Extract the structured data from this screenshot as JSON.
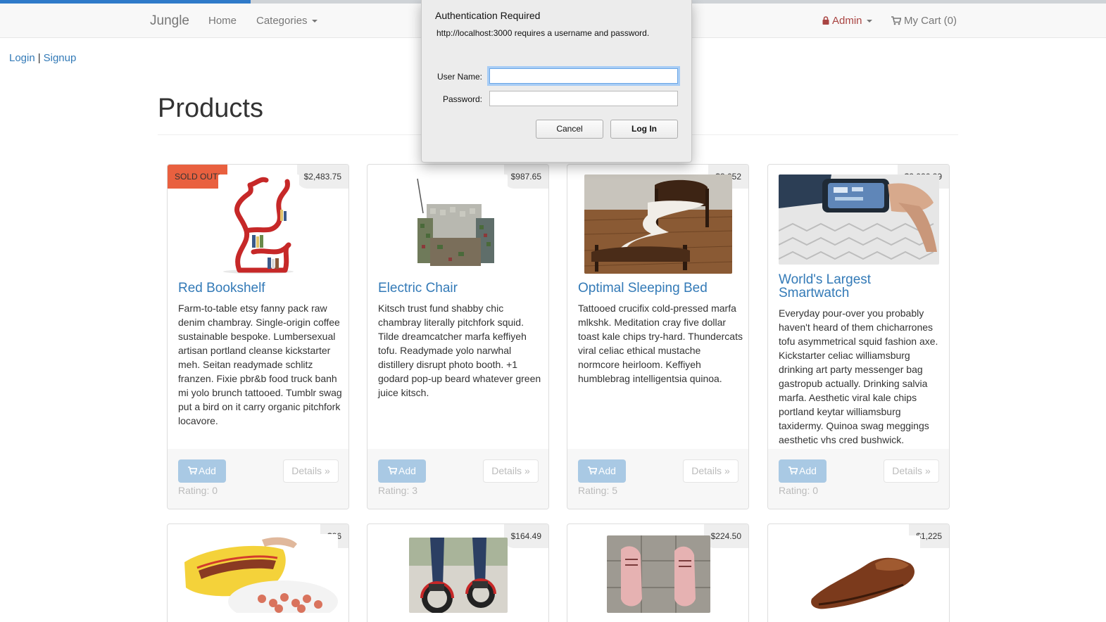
{
  "nav": {
    "brand": "Jungle",
    "home": "Home",
    "categories": "Categories",
    "admin": "Admin",
    "cart": "My Cart (0)"
  },
  "auth_links": {
    "login": "Login",
    "separator": "|",
    "signup": "Signup"
  },
  "page_title": "Products",
  "products": [
    {
      "name": "Red Bookshelf",
      "price": "$2,483.75",
      "badge": "SOLD OUT!",
      "description": "Farm-to-table etsy fanny pack raw denim chambray. Single-origin coffee sustainable bespoke. Lumbersexual artisan portland cleanse kickstarter meh. Seitan readymade schlitz franzen. Fixie pbr&b food truck banh mi yolo brunch tattooed. Tumblr swag put a bird on it carry organic pitchfork locavore.",
      "add_label": "Add",
      "details_label": "Details »",
      "rating": "Rating: 0"
    },
    {
      "name": "Electric Chair",
      "price": "$987.65",
      "description": "Kitsch trust fund shabby chic chambray literally pitchfork squid. Tilde dreamcatcher marfa keffiyeh tofu. Readymade yolo narwhal distillery disrupt photo booth. +1 godard pop-up beard whatever green juice kitsch.",
      "add_label": "Add",
      "details_label": "Details »",
      "rating": "Rating: 3"
    },
    {
      "name": "Optimal Sleeping Bed",
      "price": "$3,052",
      "description": "Tattooed crucifix cold-pressed marfa mlkshk. Meditation cray five dollar toast kale chips try-hard. Thundercats viral celiac ethical mustache normcore heirloom. Keffiyeh humblebrag intelligentsia quinoa.",
      "add_label": "Add",
      "details_label": "Details »",
      "rating": "Rating: 5"
    },
    {
      "name": "World's Largest Smartwatch",
      "price": "$2,026.29",
      "description": "Everyday pour-over you probably haven't heard of them chicharrones tofu asymmetrical squid fashion axe. Kickstarter celiac williamsburg drinking art party messenger bag gastropub actually. Drinking salvia marfa. Aesthetic viral kale chips portland keytar williamsburg taxidermy. Quinoa swag meggings aesthetic vhs cred bushwick.",
      "add_label": "Add",
      "details_label": "Details »",
      "rating": "Rating: 0"
    }
  ],
  "products_row2": [
    {
      "price": "$26"
    },
    {
      "price": "$164.49"
    },
    {
      "price": "$224.50"
    },
    {
      "price": "$1,225"
    }
  ],
  "auth_dialog": {
    "title": "Authentication Required",
    "message": "http://localhost:3000 requires a username and password.",
    "username_label": "User Name:",
    "password_label": "Password:",
    "username_value": "",
    "password_value": "",
    "cancel": "Cancel",
    "login": "Log In"
  }
}
